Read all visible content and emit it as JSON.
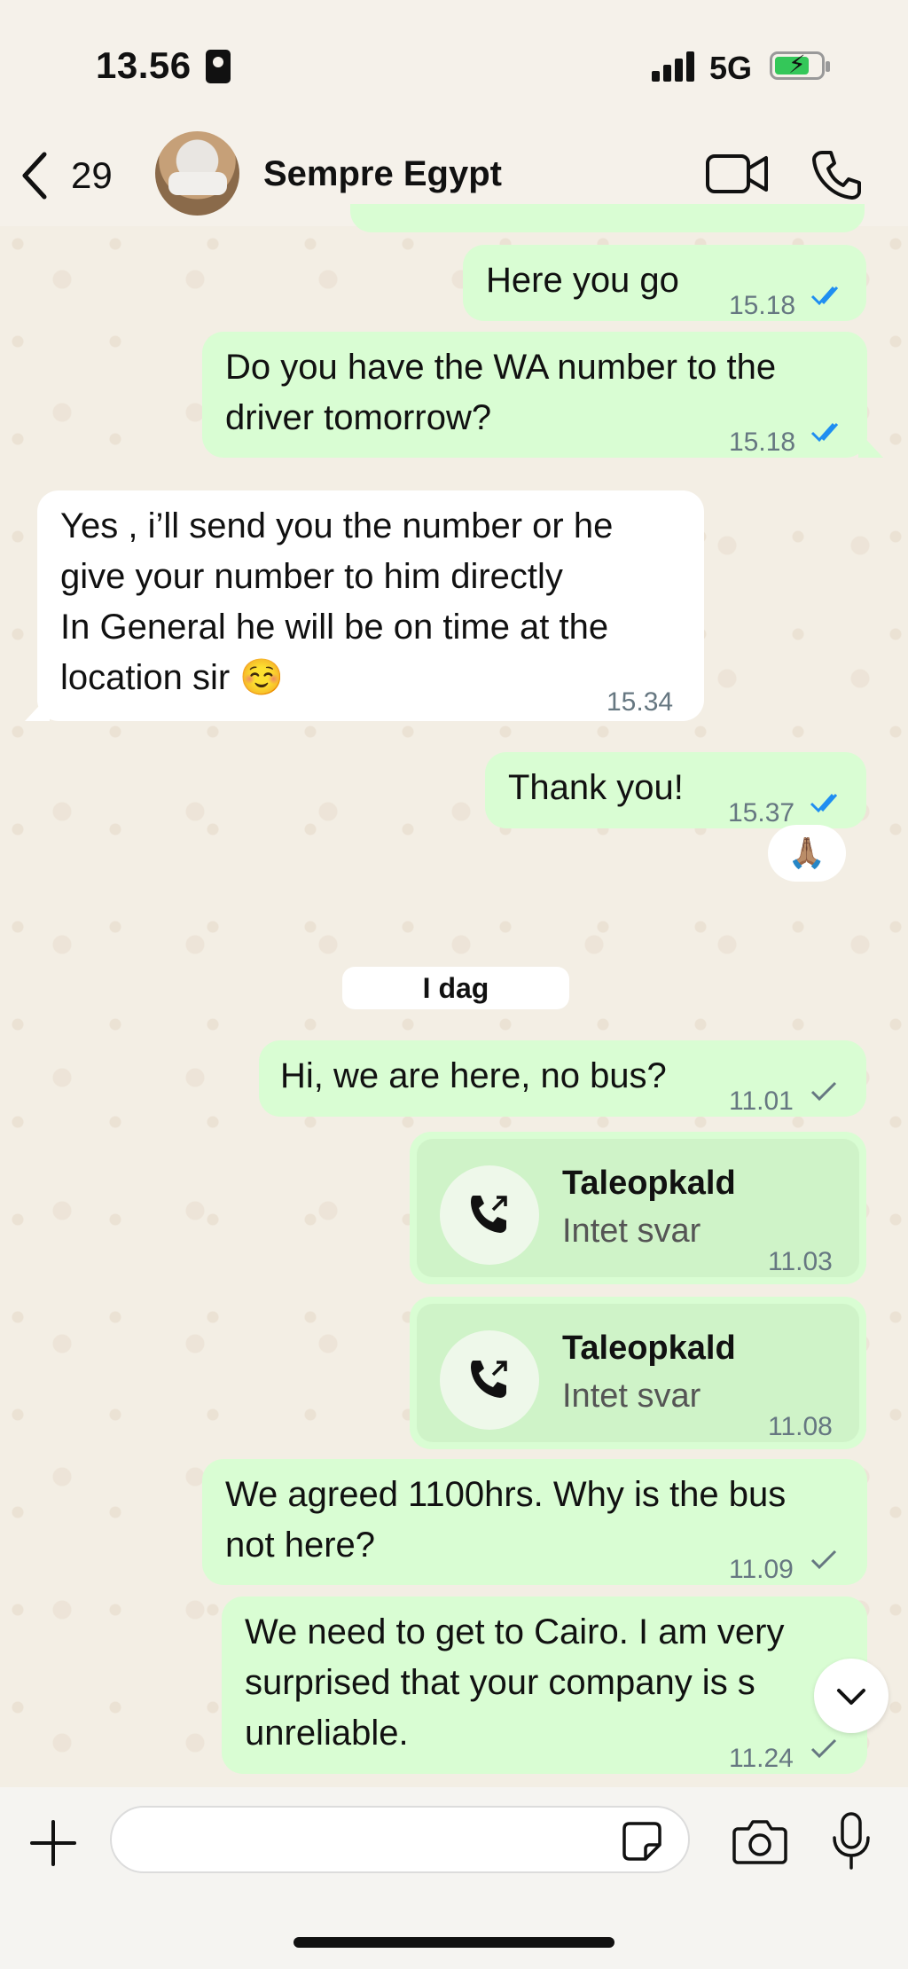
{
  "status_bar": {
    "time": "13.56",
    "network": "5G"
  },
  "header": {
    "back_count": "29",
    "contact_name": "Sempre Egypt"
  },
  "messages": [
    {
      "text": "Here you go",
      "time": "15.18"
    },
    {
      "text": "Do you have the WA number to the driver tomorrow?",
      "lines": [
        "Do you have the WA number to the",
        "driver tomorrow?"
      ],
      "time": "15.18"
    },
    {
      "lines": [
        "Yes , i’ll send you the number or he",
        "give your number to him directly",
        "In General he will be on time at the",
        "location sir ☺️"
      ],
      "time": "15.34"
    },
    {
      "text": "Thank you!",
      "time": "15.37",
      "reaction": "🙏🏽"
    },
    {
      "text": "Hi, we are here, no bus?",
      "time": "11.01"
    },
    {
      "call_title": "Taleopkald",
      "call_status": "Intet svar",
      "time": "11.03"
    },
    {
      "call_title": "Taleopkald",
      "call_status": "Intet svar",
      "time": "11.08"
    },
    {
      "lines": [
        "We agreed 1100hrs. Why is the bus",
        "not here?"
      ],
      "time": "11.09"
    },
    {
      "lines": [
        "We need to get to Cairo. I am very",
        "surprised that your company is s",
        "unreliable."
      ],
      "time": "11.24"
    }
  ],
  "date_divider": "I dag",
  "composer": {
    "placeholder": ""
  },
  "colors": {
    "outgoing": "#d9fdd3",
    "incoming": "#ffffff",
    "read_ticks": "#1f8ef1",
    "sent_ticks": "#667781"
  }
}
